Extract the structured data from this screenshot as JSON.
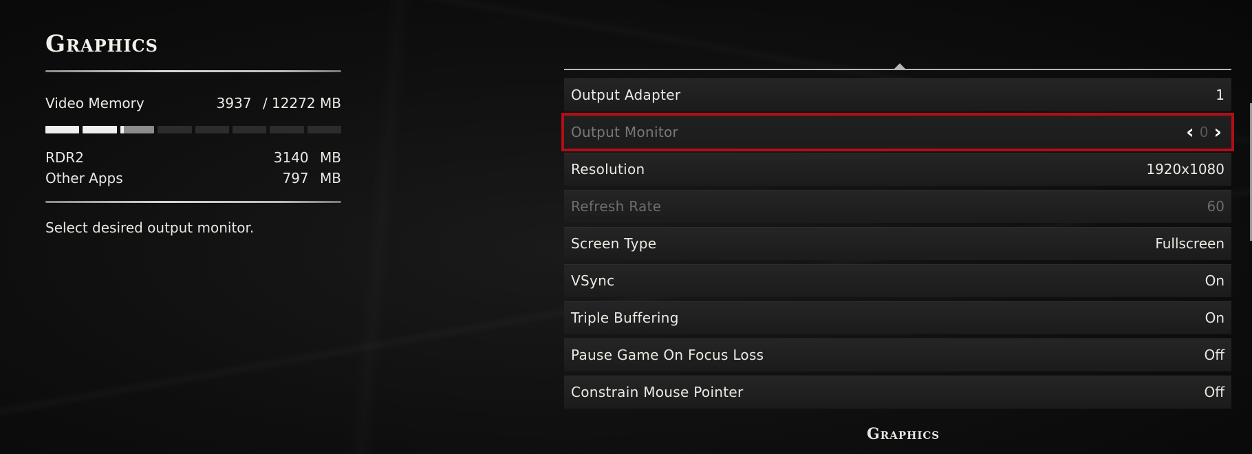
{
  "left_panel": {
    "title": "Graphics",
    "video_memory": {
      "label": "Video Memory",
      "used": "3937",
      "total": "/ 12272 MB",
      "usage_fraction": 0.32
    },
    "rdr2": {
      "label": "RDR2",
      "value": "3140",
      "unit": "MB"
    },
    "other_apps": {
      "label": "Other Apps",
      "value": "797",
      "unit": "MB"
    },
    "help_text": "Select desired output monitor."
  },
  "settings": [
    {
      "label": "Output Adapter",
      "value": "1",
      "state": "normal"
    },
    {
      "label": "Output Monitor",
      "value": "0",
      "state": "selected"
    },
    {
      "label": "Resolution",
      "value": "1920x1080",
      "state": "normal"
    },
    {
      "label": "Refresh Rate",
      "value": "60",
      "state": "disabled"
    },
    {
      "label": "Screen Type",
      "value": "Fullscreen",
      "state": "normal"
    },
    {
      "label": "VSync",
      "value": "On",
      "state": "normal"
    },
    {
      "label": "Triple Buffering",
      "value": "On",
      "state": "normal"
    },
    {
      "label": "Pause Game On Focus Loss",
      "value": "Off",
      "state": "normal"
    },
    {
      "label": "Constrain Mouse Pointer",
      "value": "Off",
      "state": "normal"
    }
  ],
  "icons": {
    "prev": "chevron-left-icon",
    "next": "chevron-right-icon"
  },
  "footer_title": "Graphics",
  "colors": {
    "selection_outline": "#b40d14",
    "background": "#111111",
    "text": "#ece9e3",
    "disabled_text": "#6f6d69"
  }
}
